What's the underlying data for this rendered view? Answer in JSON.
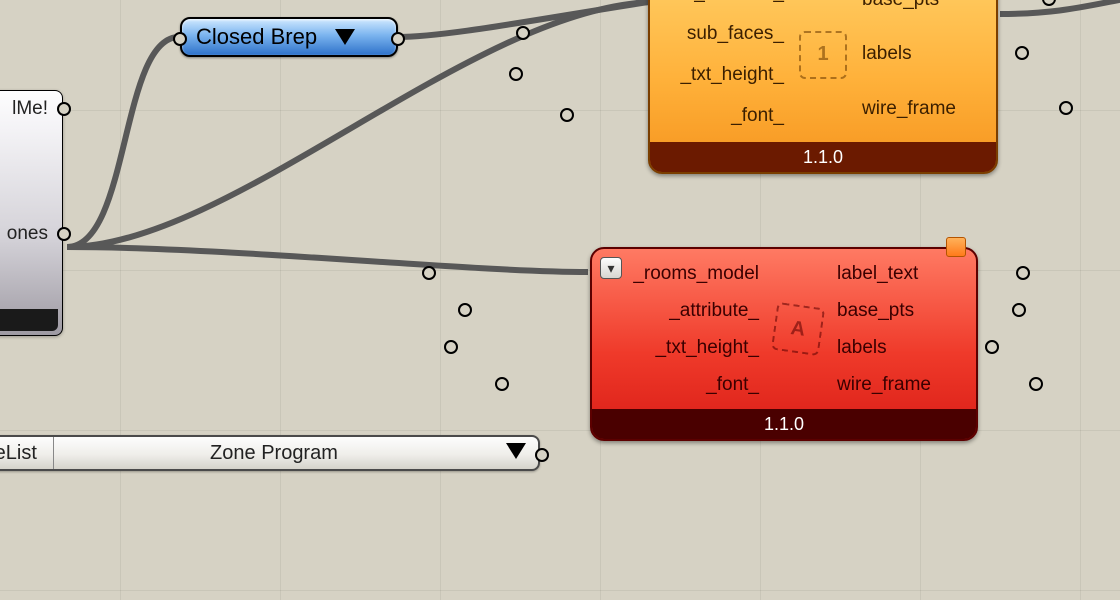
{
  "grey_panel": {
    "rows": [
      "lMe!",
      "ones"
    ]
  },
  "param_blue": {
    "label": "Closed Brep"
  },
  "attr_capsule": {
    "left_label": "uteList",
    "center_label": "Zone Program"
  },
  "comp_orange": {
    "version": "1.1.0",
    "inputs": [
      "_attribute_",
      "sub_faces_",
      "_txt_height_",
      "_font_"
    ],
    "outputs": [
      "base_pts",
      "labels",
      "wire_frame"
    ]
  },
  "comp_red": {
    "version": "1.1.0",
    "inputs": [
      "_rooms_model",
      "_attribute_",
      "_txt_height_",
      "_font_"
    ],
    "outputs": [
      "label_text",
      "base_pts",
      "labels",
      "wire_frame"
    ],
    "icon_char": "A"
  }
}
